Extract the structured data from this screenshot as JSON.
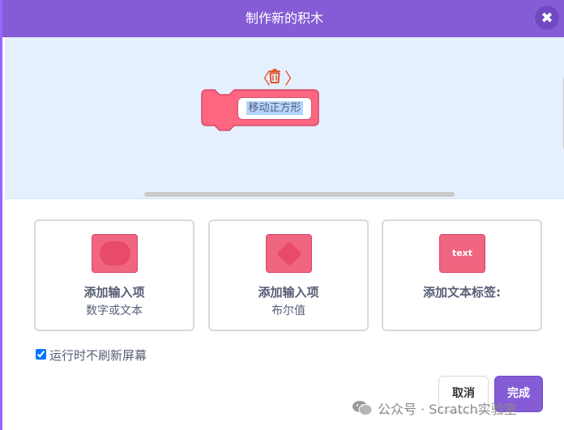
{
  "dialog": {
    "title": "制作新的积木",
    "close_icon_glyph": "✖"
  },
  "block": {
    "name_value": "移动正方形",
    "color": "#ff6680",
    "tools": {
      "left_glyph": "〈",
      "right_glyph": "〉",
      "trash_icon": "trash-icon"
    }
  },
  "options": [
    {
      "title": "添加输入项",
      "subtitle": "数字或文本",
      "icon": "round-input-icon"
    },
    {
      "title": "添加输入项",
      "subtitle": "布尔值",
      "icon": "boolean-input-icon"
    },
    {
      "title": "添加文本标签:",
      "subtitle": "",
      "icon": "text-label-icon",
      "icon_text": "text"
    }
  ],
  "run_without_refresh": {
    "label": "运行时不刷新屏幕",
    "checked": true
  },
  "buttons": {
    "cancel": "取消",
    "done": "完成"
  },
  "watermark": {
    "text": "公众号 · Scratch实验室"
  },
  "colors": {
    "header": "#855cd6",
    "accent": "#9966ff",
    "preview_bg": "#e5f0ff",
    "block": "#ff6680",
    "tool": "#e0582f"
  }
}
